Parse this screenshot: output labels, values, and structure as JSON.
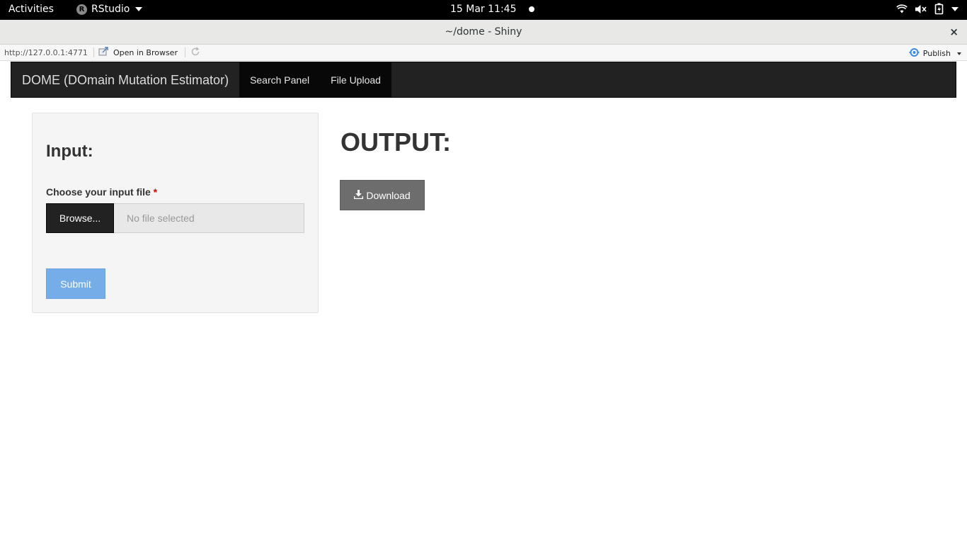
{
  "system_bar": {
    "activities": "Activities",
    "app_name": "RStudio",
    "app_badge": "R",
    "clock": "15 Mar  11:45"
  },
  "window": {
    "title": "~/dome - Shiny",
    "close": "×"
  },
  "viewer": {
    "url": "http://127.0.0.1:4771",
    "open_in_browser": "Open in Browser",
    "publish": "Publish"
  },
  "navbar": {
    "brand": "DOME (DOmain Mutation Estimator)",
    "tabs": [
      {
        "label": "Search Panel"
      },
      {
        "label": "File Upload"
      }
    ]
  },
  "sidebar": {
    "heading": "Input:",
    "file_label": "Choose your input file",
    "required_marker": "*",
    "browse_label": "Browse...",
    "file_placeholder": "No file selected",
    "submit_label": "Submit"
  },
  "main": {
    "heading": "OUTPUT:",
    "download_label": "Download"
  },
  "colors": {
    "navbar_bg": "#222222",
    "active_tab_bg": "#080808",
    "submit_bg": "#74ade8",
    "download_bg": "#6d6d6d",
    "required": "#dd0000"
  }
}
